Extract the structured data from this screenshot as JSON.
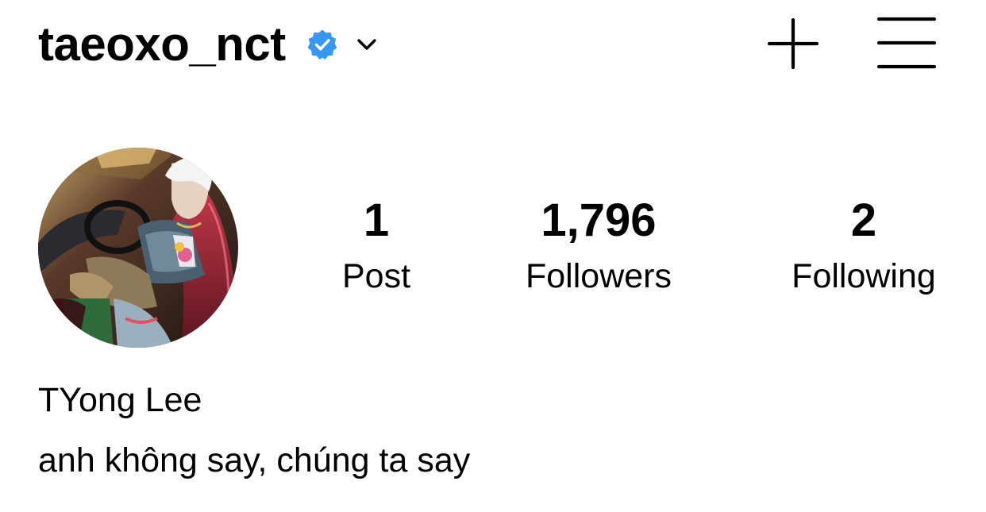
{
  "header": {
    "username": "taeoxo_nct",
    "verified": true,
    "verified_badge_color": "#3897f0",
    "icons": [
      "verified-badge-icon",
      "chevron-down-icon",
      "plus-icon",
      "menu-icon"
    ]
  },
  "profile": {
    "avatar": "profile-photo",
    "display_name": "TYong Lee",
    "bio": "anh không say, chúng ta say"
  },
  "stats": {
    "posts": {
      "count": "1",
      "label": "Post"
    },
    "followers": {
      "count": "1,796",
      "label": "Followers"
    },
    "following": {
      "count": "2",
      "label": "Following"
    }
  }
}
